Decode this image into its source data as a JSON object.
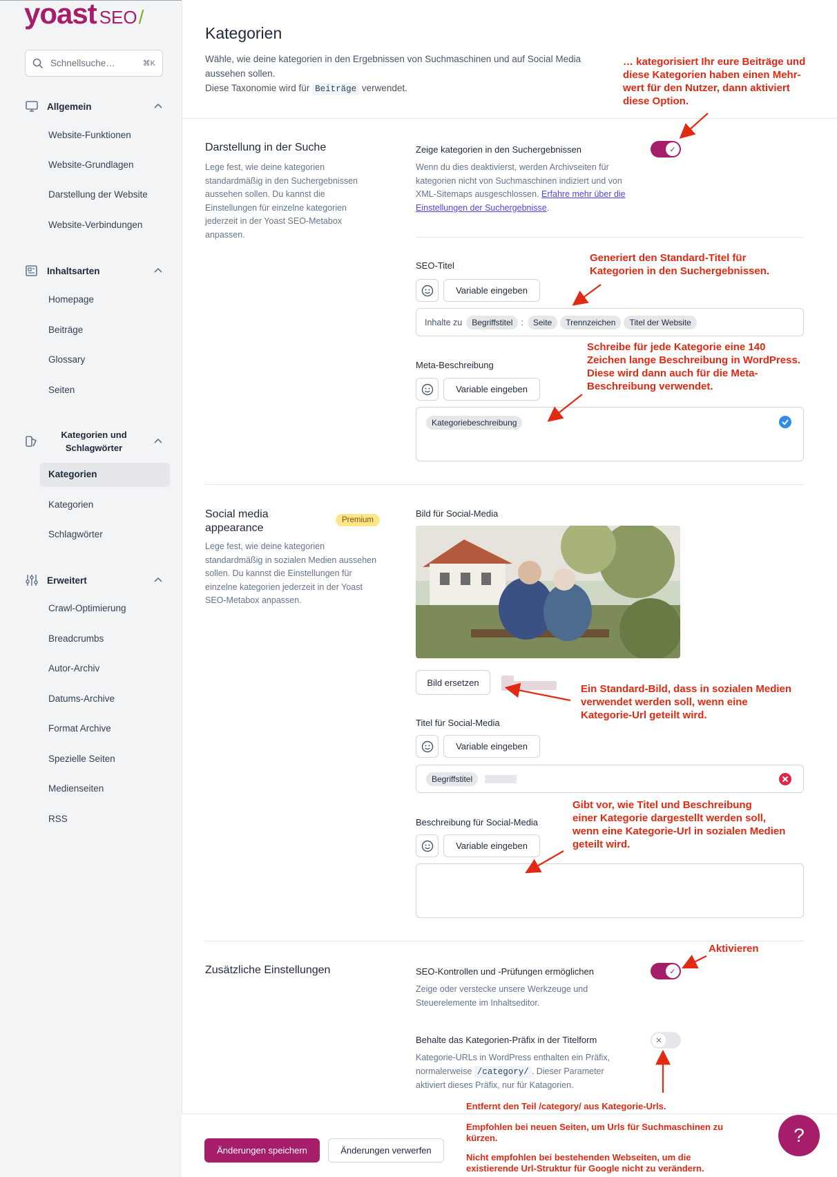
{
  "brand": {
    "logo_main": "yoast",
    "logo_suffix": "SEO",
    "logo_slash": "/"
  },
  "search": {
    "placeholder": "Schnellsuche…",
    "shortcut": "⌘K"
  },
  "sidebar": {
    "groups": [
      {
        "label": "Allgemein",
        "icon": "monitor-icon",
        "items": [
          "Website-Funktionen",
          "Website-Grundlagen",
          "Darstellung der Website",
          "Website-Verbindungen"
        ]
      },
      {
        "label": "Inhaltsarten",
        "icon": "newspaper-icon",
        "items": [
          "Homepage",
          "Beiträge",
          "Glossary",
          "Seiten"
        ]
      },
      {
        "label": "Kategorien und Schlagwörter",
        "icon": "tag-icon",
        "items": [
          "Kategorien",
          "Kategorien",
          "Schlagwörter"
        ]
      },
      {
        "label": "Erweitert",
        "icon": "sliders-icon",
        "items": [
          "Crawl-Optimierung",
          "Breadcrumbs",
          "Autor-Archiv",
          "Datums-Archive",
          "Format Archive",
          "Spezielle Seiten",
          "Medienseiten",
          "RSS"
        ]
      }
    ],
    "active_item": "Kategorien"
  },
  "page": {
    "title": "Kategorien",
    "intro_line1": "Wähle, wie deine kategorien in den Ergebnissen von Suchmaschinen und auf Social Media aussehen sollen.",
    "intro_line2_pre": "Diese Taxonomie wird für",
    "intro_code": "Beiträge",
    "intro_line2_post": "verwendet."
  },
  "search_appearance": {
    "title": "Darstellung in der Suche",
    "desc": "Lege fest, wie deine kategorien standardmäßig in den Suchergebnissen aussehen sollen. Du kannst die Einstellungen für einzelne kategorien jederzeit in der Yoast SEO-Metabox anpassen.",
    "toggle_label": "Zeige kategorien in den Suchergebnissen",
    "toggle_on": true,
    "toggle_desc": "Wenn du dies deaktivierst, werden Archivseiten für kategorien nicht von Suchmaschinen indiziert und von XML-Sitemaps ausgeschlossen.",
    "toggle_link": "Erfahre mehr über die Einstellungen der Suchergebnisse",
    "seo_title_label": "SEO-Titel",
    "variable_btn": "Variable eingeben",
    "seo_title_prefix": "Inhalte zu",
    "seo_title_vars": [
      "Begriffstitel",
      "Seite",
      "Trennzeichen",
      "Titel der Website"
    ],
    "seo_title_sep": ":",
    "meta_label": "Meta-Beschreibung",
    "meta_var": "Kategoriebeschreibung"
  },
  "social": {
    "title": "Social media appearance",
    "badge": "Premium",
    "desc": "Lege fest, wie deine kategorien standardmäßig in sozialen Medien aussehen sollen. Du kannst die Einstellungen für einzelne kategorien jederzeit in der Yoast SEO-Metabox anpassen.",
    "image_label": "Bild für Social-Media",
    "replace_btn": "Bild ersetzen",
    "title_label": "Titel für Social-Media",
    "title_var": "Begriffstitel",
    "desc_label": "Beschreibung für Social-Media",
    "variable_btn": "Variable eingeben"
  },
  "additional": {
    "title": "Zusätzliche Einstellungen",
    "seo_controls_label": "SEO-Kontrollen und -Prüfungen ermöglichen",
    "seo_controls_on": true,
    "seo_controls_desc": "Zeige oder verstecke unsere Werkzeuge und Steuerelemente im Inhaltseditor.",
    "prefix_label": "Behalte das Kategorien-Präfix in der Titelform",
    "prefix_on": false,
    "prefix_desc_pre": "Kategorie-URLs in WordPress enthalten ein Präfix, normalerweise",
    "prefix_code": "/category/",
    "prefix_desc_post": ". Dieser Parameter aktiviert dieses Präfix, nur für Katagorien."
  },
  "footer": {
    "save": "Änderungen speichern",
    "discard": "Änderungen verwerfen"
  },
  "help_label": "?",
  "annotations": {
    "a1": "… kategorisiert Ihr eure Beiträge und\ndiese Kategorien haben einen Mehr-\nwert für den Nutzer, dann aktiviert\ndiese Option.",
    "a2": "Generiert den Standard-Titel für\nKategorien in den Suchergebnissen.",
    "a3": "Schreibe für jede Kategorie eine 140\nZeichen lange Beschreibung in WordPress.\nDiese wird dann auch für die Meta-\nBeschreibung verwendet.",
    "a4": "Ein Standard-Bild, dass in sozialen Medien\nverwendet werden soll, wenn eine\nKategorie-Url geteilt wird.",
    "a5": "Gibt vor, wie Titel und Beschreibung\neiner Kategorie dargestellt werden soll,\nwenn eine Kategorie-Url in sozialen Medien\ngeteilt wird.",
    "a6": "Aktivieren",
    "a7": "Entfernt den Teil /category/ aus Kategorie-Urls.",
    "a8": "Empfohlen bei neuen Seiten, um Urls für Suchmaschinen zu\nkürzen.",
    "a9": "Nicht empfohlen bei  bestehenden Webseiten, um  die\nexistierende Url-Struktur  für Google nicht zu verändern."
  },
  "colors": {
    "brand": "#a61e69",
    "annotation": "#e02a12",
    "premium": "#fde68a"
  }
}
